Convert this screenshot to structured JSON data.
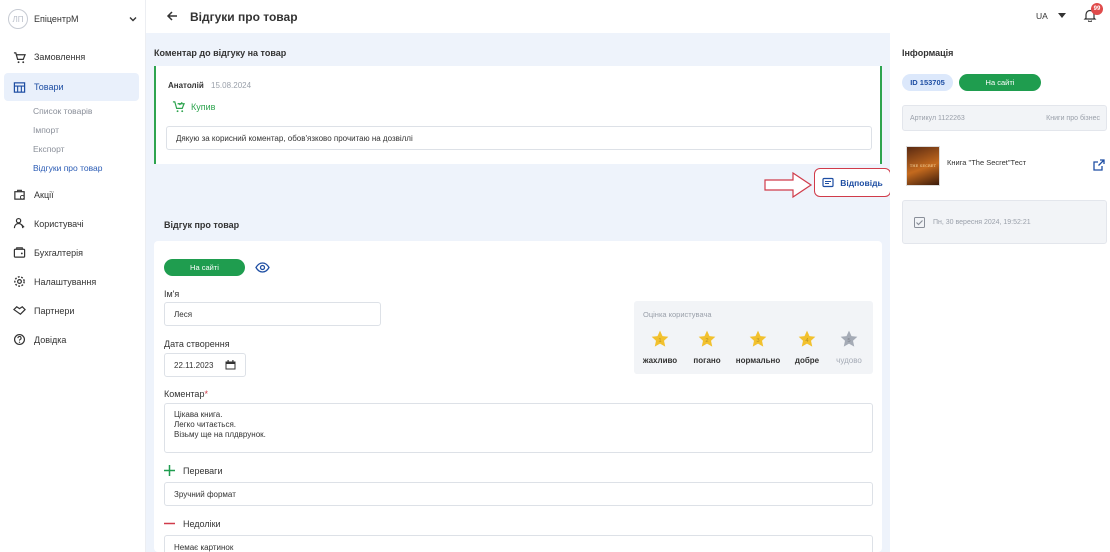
{
  "company": {
    "logo_text": "ЛП",
    "name": "ЕпіцентрМ"
  },
  "nav": [
    {
      "label": "Замовлення",
      "icon": "cart-icon"
    },
    {
      "label": "Товари",
      "icon": "products-icon"
    },
    {
      "label": "Акції",
      "icon": "promo-icon"
    },
    {
      "label": "Користувачі",
      "icon": "users-icon"
    },
    {
      "label": "Бухгалтерія",
      "icon": "wallet-icon"
    },
    {
      "label": "Налаштування",
      "icon": "gear-icon"
    },
    {
      "label": "Партнери",
      "icon": "handshake-icon"
    },
    {
      "label": "Довідка",
      "icon": "help-icon"
    }
  ],
  "subnav": [
    "Список товарів",
    "Імпорт",
    "Експорт",
    "Відгуки про товар"
  ],
  "header": {
    "title": "Відгуки про товар",
    "lang": "UA",
    "notifications": "99"
  },
  "comment_section": {
    "title": "Коментар до відгуку на товар",
    "author": "Анатолій",
    "date": "15.08.2024",
    "bought": "Купив",
    "text": "Дякую за корисний коментар, обов'язково прочитаю на дозвіллі",
    "reply": "Відповідь"
  },
  "review": {
    "title": "Відгук про товар",
    "status": "На сайті",
    "name_label": "Ім'я",
    "name": "Леся",
    "date_label": "Дата створення",
    "date": "22.11.2023",
    "rating_title": "Оцінка користувача",
    "rating": 4,
    "rating_labels": [
      "жахливо",
      "погано",
      "нормально",
      "добре",
      "чудово"
    ],
    "comment_label": "Коментар",
    "comment_lines": [
      "Цікава книга.",
      "Легко читається.",
      "Візьму ще на плдврунок."
    ],
    "pros_label": "Переваги",
    "pros": "Зручний формат",
    "cons_label": "Недоліки",
    "cons": "Немає картинок"
  },
  "info": {
    "title": "Інформація",
    "id": "ID 153705",
    "status": "На сайті",
    "article": "Артикул 1122263",
    "category": "Книги про бізнес",
    "product": "Книга \"The Secret\"Тест",
    "product_thumb_text": "THE SECRET",
    "datetime": "Пн, 30 вересня 2024, 19:52:21"
  },
  "colors": {
    "accent": "#1e4ea3",
    "green": "#1f9d4f",
    "star": "#f2c12e",
    "alert": "#d03b4a"
  }
}
